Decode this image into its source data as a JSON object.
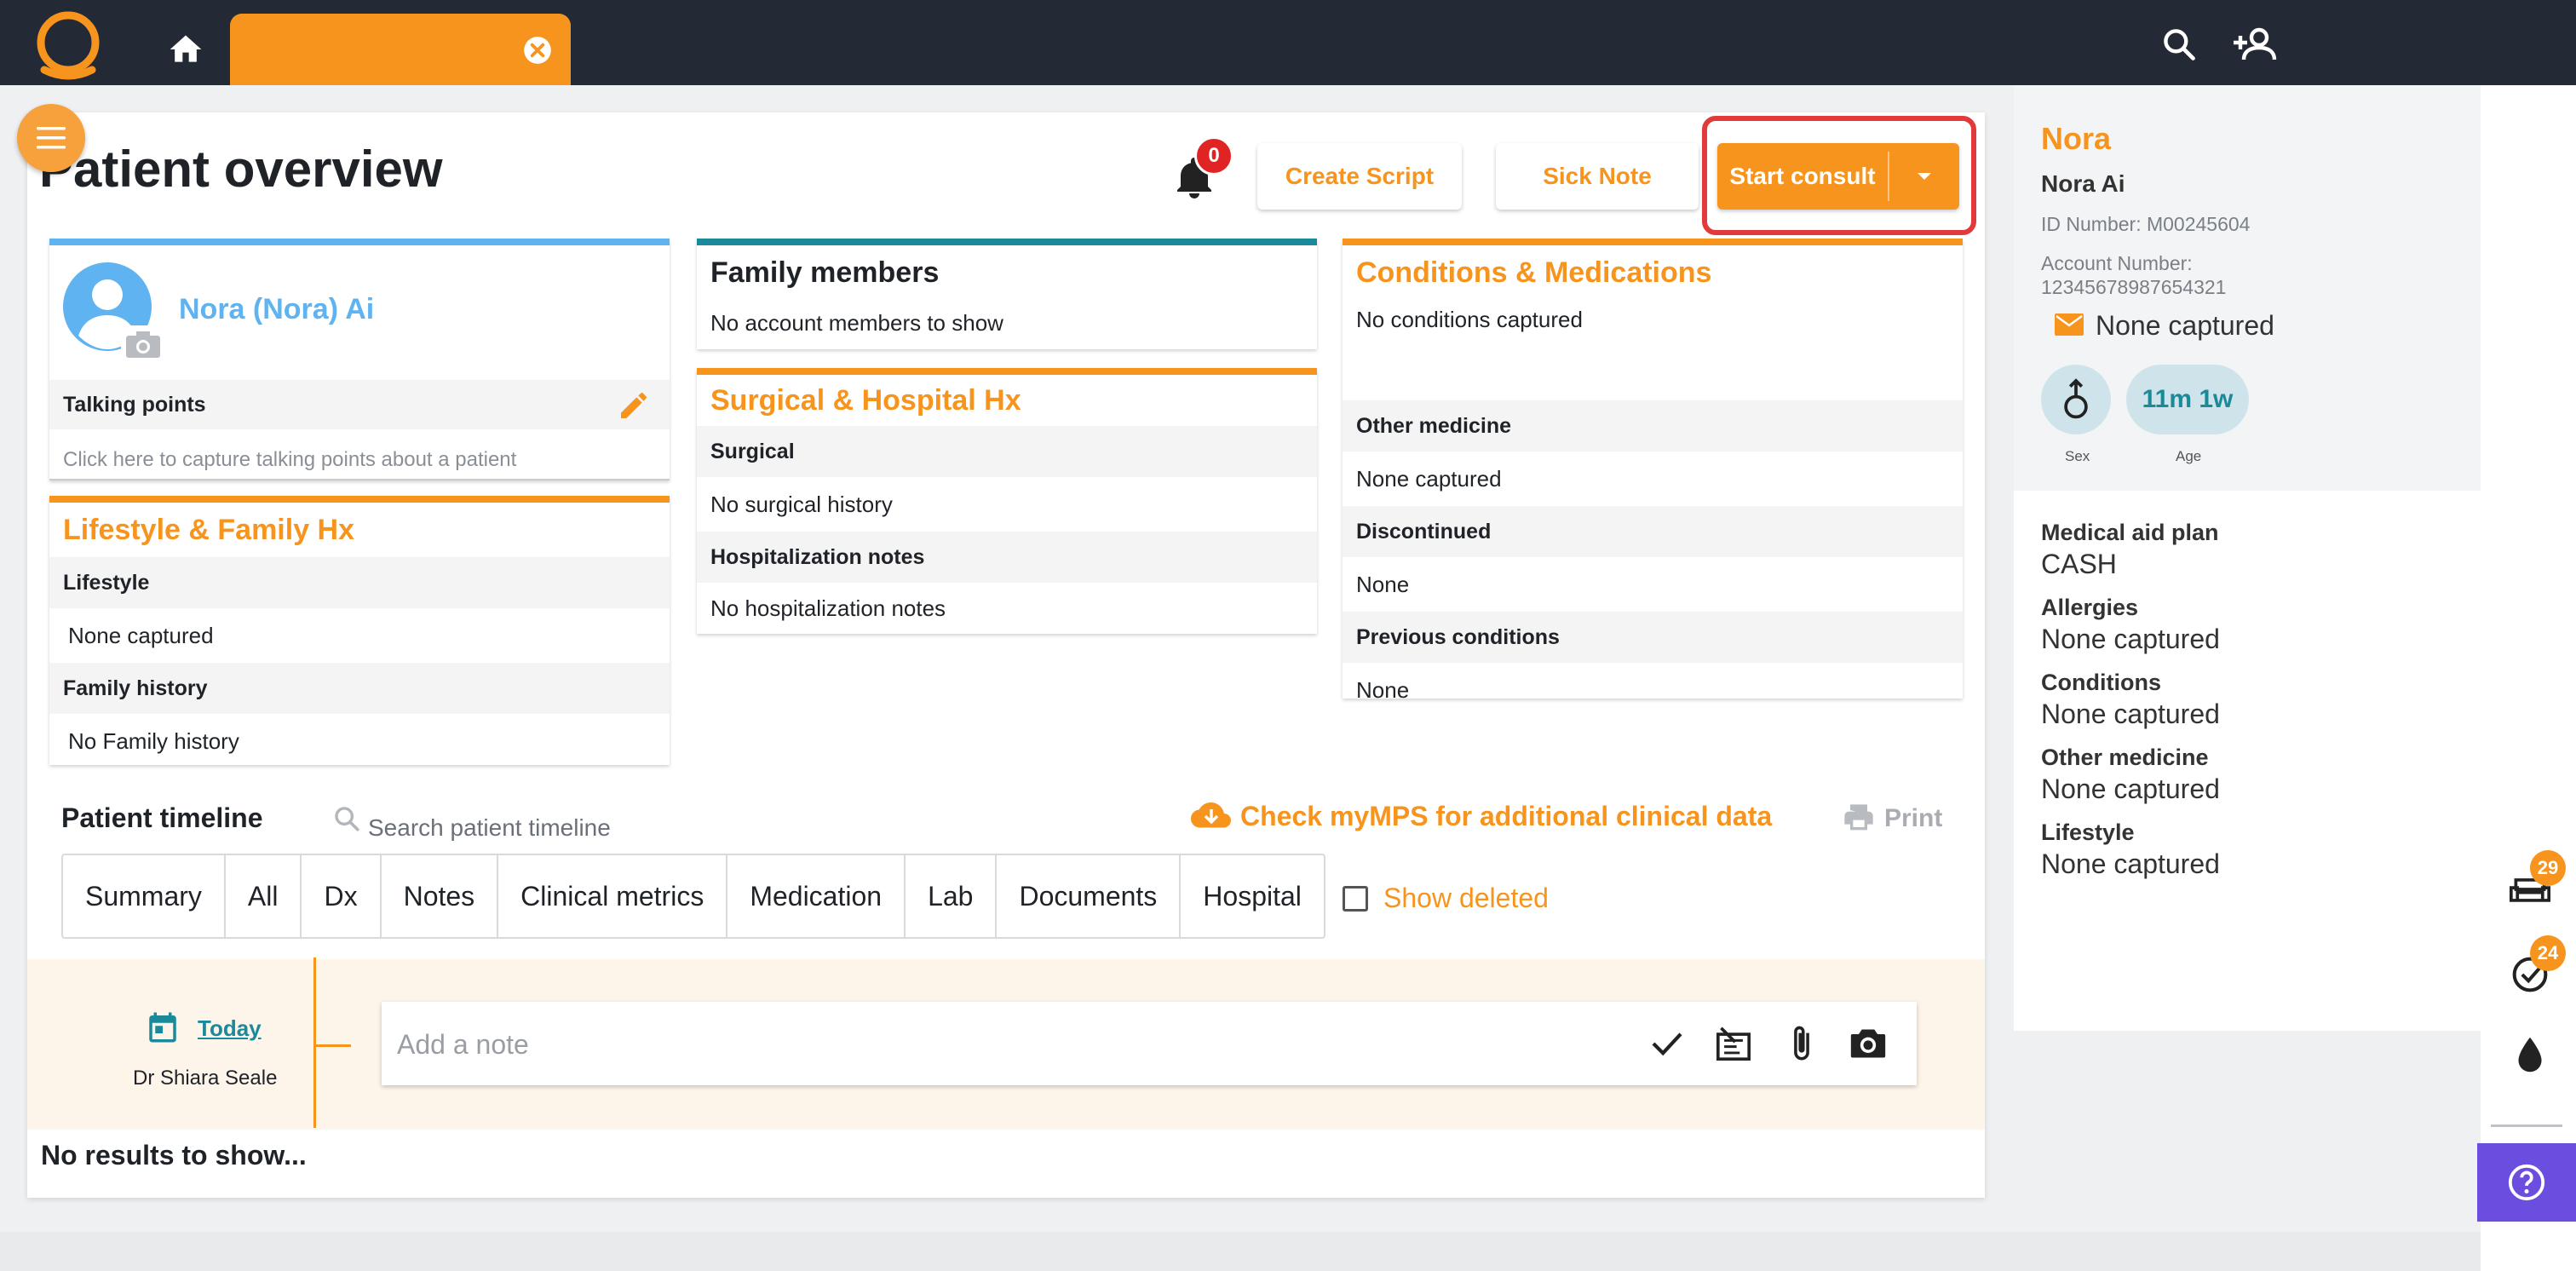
{
  "topbar": {
    "tab_label": "",
    "icons": [
      "app-logo",
      "home-icon",
      "close-icon",
      "search-icon",
      "add-user-icon"
    ]
  },
  "header": {
    "title": "Patient overview",
    "notifications_count": "0",
    "create_script": "Create Script",
    "sick_note": "Sick Note",
    "start_consult": "Start consult"
  },
  "patient_card": {
    "name": "Nora (Nora) Ai",
    "talking_points_label": "Talking points",
    "talking_points_hint": "Click here to capture talking points about a patient"
  },
  "lifestyle": {
    "title": "Lifestyle & Family Hx",
    "lifestyle_label": "Lifestyle",
    "lifestyle_value": "None captured",
    "family_label": "Family history",
    "family_value": "No Family history"
  },
  "family_members": {
    "title": "Family members",
    "value": "No account members to show"
  },
  "surgical": {
    "title": "Surgical & Hospital Hx",
    "surgical_label": "Surgical",
    "surgical_value": "No surgical history",
    "hosp_label": "Hospitalization notes",
    "hosp_value": "No hospitalization notes"
  },
  "conditions": {
    "title": "Conditions & Medications",
    "value": "No conditions captured",
    "other_label": "Other medicine",
    "other_value": "None captured",
    "disc_label": "Discontinued",
    "disc_value": "None",
    "prev_label": "Previous conditions",
    "prev_value": "None"
  },
  "timeline": {
    "title": "Patient timeline",
    "search_placeholder": "Search patient timeline",
    "mps_link": "Check myMPS for additional clinical data",
    "print": "Print",
    "tabs": [
      "Summary",
      "All",
      "Dx",
      "Notes",
      "Clinical metrics",
      "Medication",
      "Lab",
      "Documents",
      "Hospital"
    ],
    "show_deleted": "Show deleted",
    "today": "Today",
    "doctor": "Dr Shiara Seale",
    "note_placeholder": "Add a note",
    "no_results": "No results to show..."
  },
  "sidebar": {
    "first_name": "Nora",
    "full_name": "Nora Ai",
    "id_number": "ID Number: M00245604",
    "account_label": "Account Number:",
    "account_value": "12345678987654321",
    "email": "None captured",
    "sex_label": "Sex",
    "age_value": "11m 1w",
    "age_label": "Age",
    "medical_aid_label": "Medical aid plan",
    "medical_aid_value": "CASH",
    "allergies_label": "Allergies",
    "allergies_value": "None captured",
    "conditions_label": "Conditions",
    "conditions_value": "None captured",
    "other_label": "Other medicine",
    "other_value": "None captured",
    "lifestyle_label": "Lifestyle",
    "lifestyle_value": "None captured"
  },
  "rail": {
    "queue_count": "29",
    "tasks_count": "24"
  },
  "colors": {
    "accent": "#f7941d",
    "topbar": "#232a35",
    "blue": "#5fb3f0",
    "teal": "#1a8a9a",
    "alert": "#e02424",
    "help": "#6b4ee0"
  }
}
